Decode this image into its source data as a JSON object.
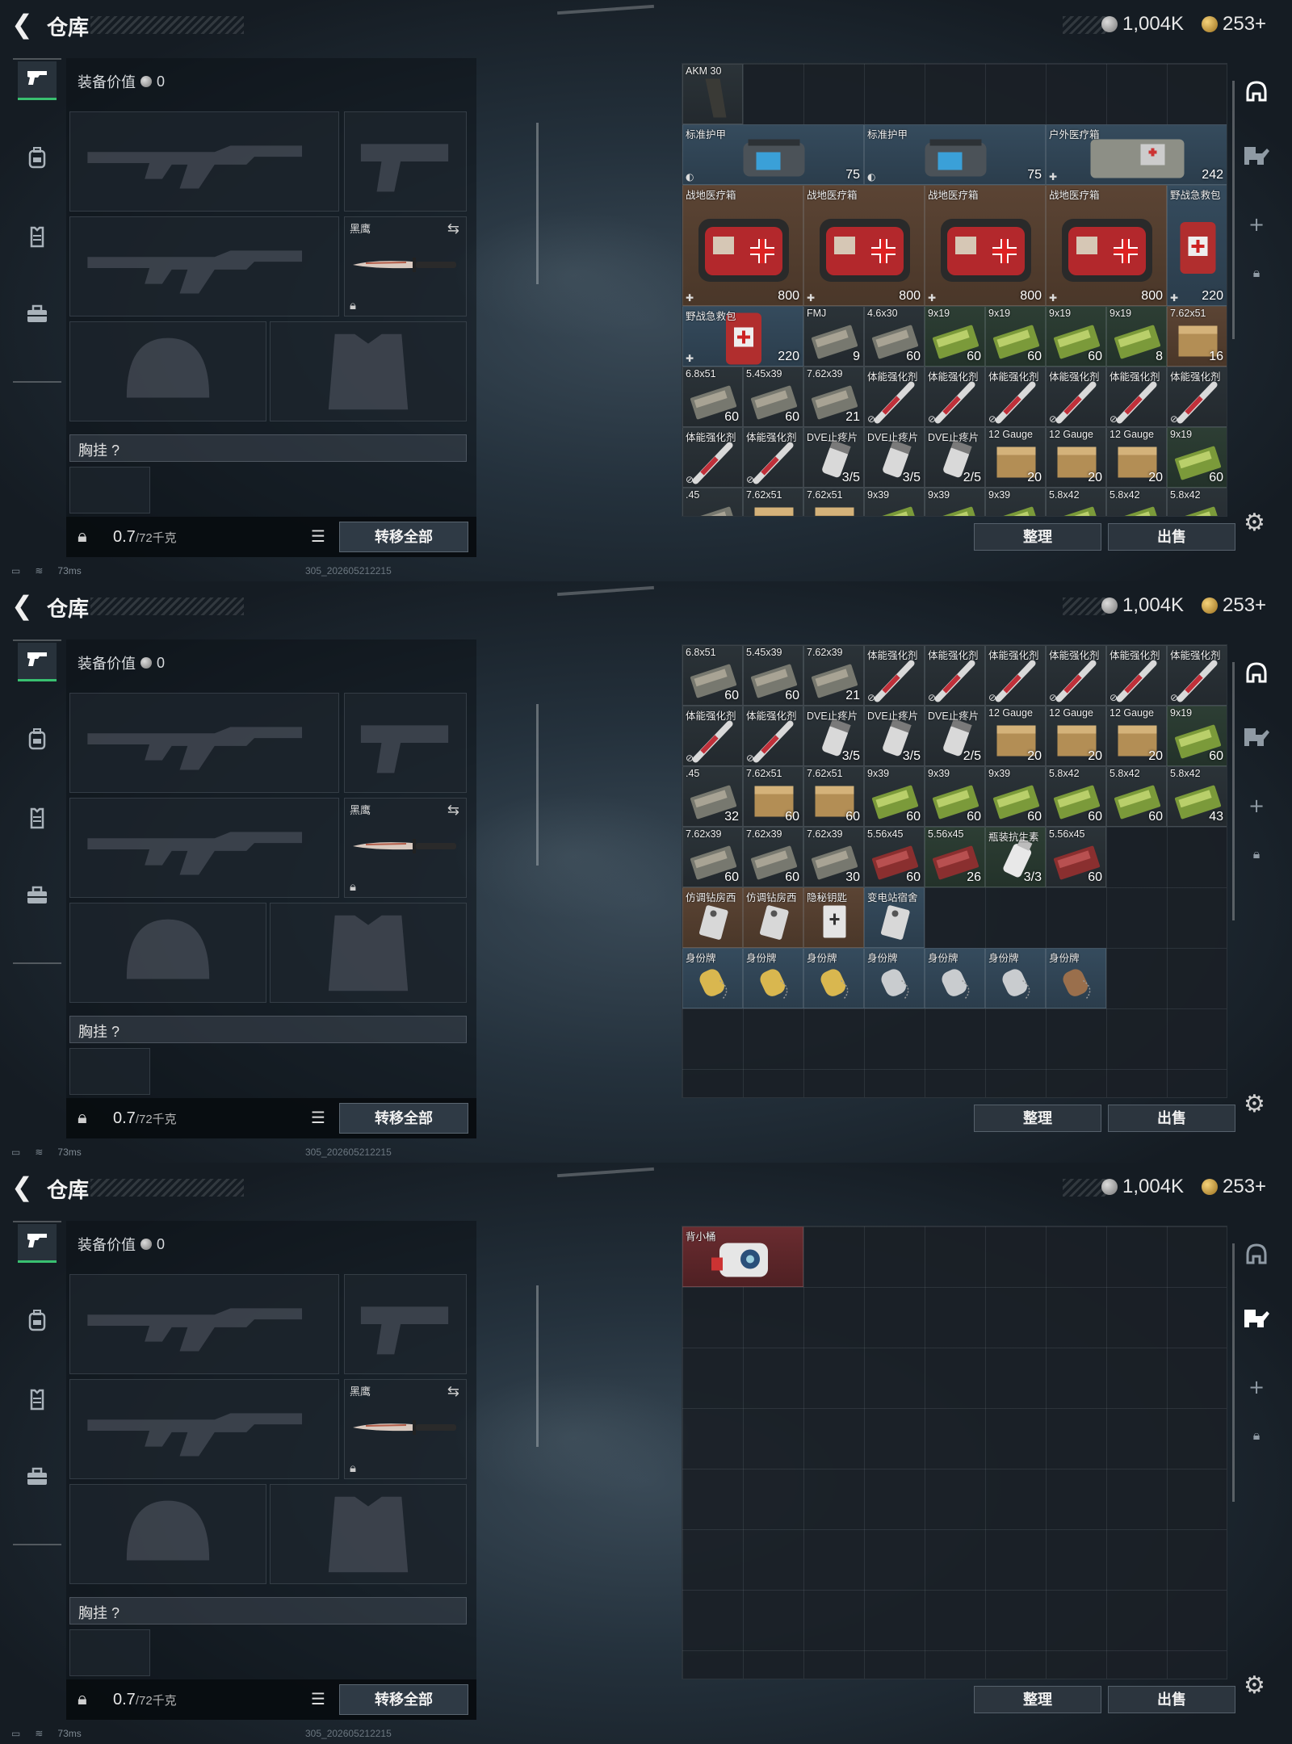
{
  "header": {
    "back_icon": "back-arrow-icon",
    "title": "仓库",
    "silver": "1,004K",
    "gold": "253+"
  },
  "left_tabs": [
    "pistol-icon",
    "backpack-icon",
    "vest-icon",
    "toolbox-icon"
  ],
  "equipment": {
    "value_label": "装备价值",
    "value": "0",
    "knife_name": "黑鹰",
    "chest_label": "胸挂",
    "chest_help": "?",
    "weight_current": "0.7",
    "weight_max": "/72千克",
    "transfer_all": "转移全部"
  },
  "status": {
    "ping": "73ms",
    "build": "305_202605212215"
  },
  "actions": {
    "sort": "整理",
    "sell": "出售"
  },
  "right_tools": [
    "helmet-icon",
    "armor-icon",
    "plus-icon",
    "lock-icon"
  ],
  "panels": [
    {
      "cells": [
        {
          "r": 0,
          "c": 0,
          "w": 1,
          "h": 1,
          "name": "AKM 30",
          "val": "",
          "bg": "dark",
          "art": "mag"
        },
        {
          "r": 1,
          "c": 0,
          "w": 3,
          "h": 1,
          "name": "标准护甲",
          "val": "75",
          "bg": "blue",
          "art": "armor",
          "corner": "◐"
        },
        {
          "r": 1,
          "c": 3,
          "w": 3,
          "h": 1,
          "name": "标准护甲",
          "val": "75",
          "bg": "blue",
          "art": "armor",
          "corner": "◐"
        },
        {
          "r": 1,
          "c": 6,
          "w": 3,
          "h": 1,
          "name": "户外医疗箱",
          "val": "242",
          "bg": "blue",
          "art": "medbag",
          "corner": "✚"
        },
        {
          "r": 2,
          "c": 0,
          "w": 2,
          "h": 2,
          "name": "战地医疗箱",
          "val": "800",
          "bg": "brown",
          "art": "firstaid",
          "corner": "✚"
        },
        {
          "r": 2,
          "c": 2,
          "w": 2,
          "h": 2,
          "name": "战地医疗箱",
          "val": "800",
          "bg": "brown",
          "art": "firstaid",
          "corner": "✚"
        },
        {
          "r": 2,
          "c": 4,
          "w": 2,
          "h": 2,
          "name": "战地医疗箱",
          "val": "800",
          "bg": "brown",
          "art": "firstaid",
          "corner": "✚"
        },
        {
          "r": 2,
          "c": 6,
          "w": 2,
          "h": 2,
          "name": "战地医疗箱",
          "val": "800",
          "bg": "brown",
          "art": "firstaid",
          "corner": "✚"
        },
        {
          "r": 2,
          "c": 8,
          "w": 1,
          "h": 2,
          "name": "野战急救包",
          "val": "220",
          "bg": "blue",
          "art": "redkit",
          "corner": "✚"
        },
        {
          "r": 4,
          "c": 0,
          "w": 2,
          "h": 1,
          "name": "野战急救包",
          "val": "220",
          "bg": "blue",
          "art": "redkit",
          "corner": "✚"
        },
        {
          "r": 4,
          "c": 2,
          "w": 1,
          "h": 1,
          "name": "FMJ",
          "val": "9",
          "bg": "dark",
          "art": "ammo-grey"
        },
        {
          "r": 4,
          "c": 3,
          "w": 1,
          "h": 1,
          "name": "4.6x30",
          "val": "60",
          "bg": "dark",
          "art": "ammo-grey"
        },
        {
          "r": 4,
          "c": 4,
          "w": 1,
          "h": 1,
          "name": "9x19",
          "val": "60",
          "bg": "green",
          "art": "ammo-green"
        },
        {
          "r": 4,
          "c": 5,
          "w": 1,
          "h": 1,
          "name": "9x19",
          "val": "60",
          "bg": "green",
          "art": "ammo-green"
        },
        {
          "r": 4,
          "c": 6,
          "w": 1,
          "h": 1,
          "name": "9x19",
          "val": "60",
          "bg": "green",
          "art": "ammo-green"
        },
        {
          "r": 4,
          "c": 7,
          "w": 1,
          "h": 1,
          "name": "9x19",
          "val": "8",
          "bg": "green",
          "art": "ammo-green"
        },
        {
          "r": 4,
          "c": 8,
          "w": 1,
          "h": 1,
          "name": "7.62x51",
          "val": "16",
          "bg": "brown",
          "art": "ammo-box"
        },
        {
          "r": 5,
          "c": 0,
          "w": 1,
          "h": 1,
          "name": "6.8x51",
          "val": "60",
          "bg": "dark",
          "art": "ammo-grey"
        },
        {
          "r": 5,
          "c": 1,
          "w": 1,
          "h": 1,
          "name": "5.45x39",
          "val": "60",
          "bg": "dark",
          "art": "ammo-grey"
        },
        {
          "r": 5,
          "c": 2,
          "w": 1,
          "h": 1,
          "name": "7.62x39",
          "val": "21",
          "bg": "dark",
          "art": "ammo-grey"
        },
        {
          "r": 5,
          "c": 3,
          "w": 1,
          "h": 1,
          "name": "体能强化剂",
          "val": "",
          "bg": "dark",
          "art": "syringe",
          "corner": "⊘"
        },
        {
          "r": 5,
          "c": 4,
          "w": 1,
          "h": 1,
          "name": "体能强化剂",
          "val": "",
          "bg": "dark",
          "art": "syringe",
          "corner": "⊘"
        },
        {
          "r": 5,
          "c": 5,
          "w": 1,
          "h": 1,
          "name": "体能强化剂",
          "val": "",
          "bg": "dark",
          "art": "syringe",
          "corner": "⊘"
        },
        {
          "r": 5,
          "c": 6,
          "w": 1,
          "h": 1,
          "name": "体能强化剂",
          "val": "",
          "bg": "dark",
          "art": "syringe",
          "corner": "⊘"
        },
        {
          "r": 5,
          "c": 7,
          "w": 1,
          "h": 1,
          "name": "体能强化剂",
          "val": "",
          "bg": "dark",
          "art": "syringe",
          "corner": "⊘"
        },
        {
          "r": 5,
          "c": 8,
          "w": 1,
          "h": 1,
          "name": "体能强化剂",
          "val": "",
          "bg": "dark",
          "art": "syringe",
          "corner": "⊘"
        },
        {
          "r": 6,
          "c": 0,
          "w": 1,
          "h": 1,
          "name": "体能强化剂",
          "val": "",
          "bg": "dark",
          "art": "syringe",
          "corner": "⊘"
        },
        {
          "r": 6,
          "c": 1,
          "w": 1,
          "h": 1,
          "name": "体能强化剂",
          "val": "",
          "bg": "dark",
          "art": "syringe",
          "corner": "⊘"
        },
        {
          "r": 6,
          "c": 2,
          "w": 1,
          "h": 1,
          "name": "DVE止疼片",
          "val": "3/5",
          "bg": "dark",
          "art": "pills"
        },
        {
          "r": 6,
          "c": 3,
          "w": 1,
          "h": 1,
          "name": "DVE止疼片",
          "val": "3/5",
          "bg": "dark",
          "art": "pills"
        },
        {
          "r": 6,
          "c": 4,
          "w": 1,
          "h": 1,
          "name": "DVE止疼片",
          "val": "2/5",
          "bg": "dark",
          "art": "pills"
        },
        {
          "r": 6,
          "c": 5,
          "w": 1,
          "h": 1,
          "name": "12 Gauge",
          "val": "20",
          "bg": "dark",
          "art": "ammo-box"
        },
        {
          "r": 6,
          "c": 6,
          "w": 1,
          "h": 1,
          "name": "12 Gauge",
          "val": "20",
          "bg": "dark",
          "art": "ammo-box"
        },
        {
          "r": 6,
          "c": 7,
          "w": 1,
          "h": 1,
          "name": "12 Gauge",
          "val": "20",
          "bg": "dark",
          "art": "ammo-box"
        },
        {
          "r": 6,
          "c": 8,
          "w": 1,
          "h": 1,
          "name": "9x19",
          "val": "60",
          "bg": "green",
          "art": "ammo-green"
        },
        {
          "r": 7,
          "c": 0,
          "w": 1,
          "h": 1,
          "name": ".45",
          "val": "",
          "bg": "dark",
          "art": "ammo-grey"
        },
        {
          "r": 7,
          "c": 1,
          "w": 1,
          "h": 1,
          "name": "7.62x51",
          "val": "",
          "bg": "dark",
          "art": "ammo-box"
        },
        {
          "r": 7,
          "c": 2,
          "w": 1,
          "h": 1,
          "name": "7.62x51",
          "val": "",
          "bg": "dark",
          "art": "ammo-box"
        },
        {
          "r": 7,
          "c": 3,
          "w": 1,
          "h": 1,
          "name": "9x39",
          "val": "",
          "bg": "dark",
          "art": "ammo-green"
        },
        {
          "r": 7,
          "c": 4,
          "w": 1,
          "h": 1,
          "name": "9x39",
          "val": "",
          "bg": "dark",
          "art": "ammo-green"
        },
        {
          "r": 7,
          "c": 5,
          "w": 1,
          "h": 1,
          "name": "9x39",
          "val": "",
          "bg": "dark",
          "art": "ammo-green"
        },
        {
          "r": 7,
          "c": 6,
          "w": 1,
          "h": 1,
          "name": "5.8x42",
          "val": "",
          "bg": "dark",
          "art": "ammo-green"
        },
        {
          "r": 7,
          "c": 7,
          "w": 1,
          "h": 1,
          "name": "5.8x42",
          "val": "",
          "bg": "dark",
          "art": "ammo-green"
        },
        {
          "r": 7,
          "c": 8,
          "w": 1,
          "h": 1,
          "name": "5.8x42",
          "val": "",
          "bg": "dark",
          "art": "ammo-green"
        }
      ]
    },
    {
      "cells": [
        {
          "r": 0,
          "c": 0,
          "w": 1,
          "h": 1,
          "name": "6.8x51",
          "val": "60",
          "bg": "dark",
          "art": "ammo-grey"
        },
        {
          "r": 0,
          "c": 1,
          "w": 1,
          "h": 1,
          "name": "5.45x39",
          "val": "60",
          "bg": "dark",
          "art": "ammo-grey"
        },
        {
          "r": 0,
          "c": 2,
          "w": 1,
          "h": 1,
          "name": "7.62x39",
          "val": "21",
          "bg": "dark",
          "art": "ammo-grey"
        },
        {
          "r": 0,
          "c": 3,
          "w": 1,
          "h": 1,
          "name": "体能强化剂",
          "val": "",
          "bg": "dark",
          "art": "syringe",
          "corner": "⊘"
        },
        {
          "r": 0,
          "c": 4,
          "w": 1,
          "h": 1,
          "name": "体能强化剂",
          "val": "",
          "bg": "dark",
          "art": "syringe",
          "corner": "⊘"
        },
        {
          "r": 0,
          "c": 5,
          "w": 1,
          "h": 1,
          "name": "体能强化剂",
          "val": "",
          "bg": "dark",
          "art": "syringe",
          "corner": "⊘"
        },
        {
          "r": 0,
          "c": 6,
          "w": 1,
          "h": 1,
          "name": "体能强化剂",
          "val": "",
          "bg": "dark",
          "art": "syringe",
          "corner": "⊘"
        },
        {
          "r": 0,
          "c": 7,
          "w": 1,
          "h": 1,
          "name": "体能强化剂",
          "val": "",
          "bg": "dark",
          "art": "syringe",
          "corner": "⊘"
        },
        {
          "r": 0,
          "c": 8,
          "w": 1,
          "h": 1,
          "name": "体能强化剂",
          "val": "",
          "bg": "dark",
          "art": "syringe",
          "corner": "⊘"
        },
        {
          "r": 1,
          "c": 0,
          "w": 1,
          "h": 1,
          "name": "体能强化剂",
          "val": "",
          "bg": "dark",
          "art": "syringe",
          "corner": "⊘"
        },
        {
          "r": 1,
          "c": 1,
          "w": 1,
          "h": 1,
          "name": "体能强化剂",
          "val": "",
          "bg": "dark",
          "art": "syringe",
          "corner": "⊘"
        },
        {
          "r": 1,
          "c": 2,
          "w": 1,
          "h": 1,
          "name": "DVE止疼片",
          "val": "3/5",
          "bg": "dark",
          "art": "pills"
        },
        {
          "r": 1,
          "c": 3,
          "w": 1,
          "h": 1,
          "name": "DVE止疼片",
          "val": "3/5",
          "bg": "dark",
          "art": "pills"
        },
        {
          "r": 1,
          "c": 4,
          "w": 1,
          "h": 1,
          "name": "DVE止疼片",
          "val": "2/5",
          "bg": "dark",
          "art": "pills"
        },
        {
          "r": 1,
          "c": 5,
          "w": 1,
          "h": 1,
          "name": "12 Gauge",
          "val": "20",
          "bg": "dark",
          "art": "ammo-box"
        },
        {
          "r": 1,
          "c": 6,
          "w": 1,
          "h": 1,
          "name": "12 Gauge",
          "val": "20",
          "bg": "dark",
          "art": "ammo-box"
        },
        {
          "r": 1,
          "c": 7,
          "w": 1,
          "h": 1,
          "name": "12 Gauge",
          "val": "20",
          "bg": "dark",
          "art": "ammo-box"
        },
        {
          "r": 1,
          "c": 8,
          "w": 1,
          "h": 1,
          "name": "9x19",
          "val": "60",
          "bg": "green",
          "art": "ammo-green"
        },
        {
          "r": 2,
          "c": 0,
          "w": 1,
          "h": 1,
          "name": ".45",
          "val": "32",
          "bg": "dark",
          "art": "ammo-grey"
        },
        {
          "r": 2,
          "c": 1,
          "w": 1,
          "h": 1,
          "name": "7.62x51",
          "val": "60",
          "bg": "dark",
          "art": "ammo-box"
        },
        {
          "r": 2,
          "c": 2,
          "w": 1,
          "h": 1,
          "name": "7.62x51",
          "val": "60",
          "bg": "dark",
          "art": "ammo-box"
        },
        {
          "r": 2,
          "c": 3,
          "w": 1,
          "h": 1,
          "name": "9x39",
          "val": "60",
          "bg": "dark",
          "art": "ammo-green"
        },
        {
          "r": 2,
          "c": 4,
          "w": 1,
          "h": 1,
          "name": "9x39",
          "val": "60",
          "bg": "dark",
          "art": "ammo-green"
        },
        {
          "r": 2,
          "c": 5,
          "w": 1,
          "h": 1,
          "name": "9x39",
          "val": "60",
          "bg": "dark",
          "art": "ammo-green"
        },
        {
          "r": 2,
          "c": 6,
          "w": 1,
          "h": 1,
          "name": "5.8x42",
          "val": "60",
          "bg": "dark",
          "art": "ammo-green"
        },
        {
          "r": 2,
          "c": 7,
          "w": 1,
          "h": 1,
          "name": "5.8x42",
          "val": "60",
          "bg": "dark",
          "art": "ammo-green"
        },
        {
          "r": 2,
          "c": 8,
          "w": 1,
          "h": 1,
          "name": "5.8x42",
          "val": "43",
          "bg": "dark",
          "art": "ammo-green"
        },
        {
          "r": 3,
          "c": 0,
          "w": 1,
          "h": 1,
          "name": "7.62x39",
          "val": "60",
          "bg": "dark",
          "art": "ammo-grey"
        },
        {
          "r": 3,
          "c": 1,
          "w": 1,
          "h": 1,
          "name": "7.62x39",
          "val": "60",
          "bg": "dark",
          "art": "ammo-grey"
        },
        {
          "r": 3,
          "c": 2,
          "w": 1,
          "h": 1,
          "name": "7.62x39",
          "val": "30",
          "bg": "dark",
          "art": "ammo-grey"
        },
        {
          "r": 3,
          "c": 3,
          "w": 1,
          "h": 1,
          "name": "5.56x45",
          "val": "60",
          "bg": "dark",
          "art": "ammo-red"
        },
        {
          "r": 3,
          "c": 4,
          "w": 1,
          "h": 1,
          "name": "5.56x45",
          "val": "26",
          "bg": "green",
          "art": "ammo-red"
        },
        {
          "r": 3,
          "c": 5,
          "w": 1,
          "h": 1,
          "name": "瓶装抗生素",
          "val": "3/3",
          "bg": "green",
          "art": "bottle"
        },
        {
          "r": 3,
          "c": 6,
          "w": 1,
          "h": 1,
          "name": "5.56x45",
          "val": "60",
          "bg": "dark",
          "art": "ammo-red"
        },
        {
          "r": 4,
          "c": 0,
          "w": 1,
          "h": 1,
          "name": "仿调钻房西",
          "val": "",
          "bg": "brown",
          "art": "tag"
        },
        {
          "r": 4,
          "c": 1,
          "w": 1,
          "h": 1,
          "name": "仿调钻房西",
          "val": "",
          "bg": "brown",
          "art": "tag"
        },
        {
          "r": 4,
          "c": 2,
          "w": 1,
          "h": 1,
          "name": "隐秘钥匙",
          "val": "",
          "bg": "brown",
          "art": "card"
        },
        {
          "r": 4,
          "c": 3,
          "w": 1,
          "h": 1,
          "name": "变电站宿舍",
          "val": "",
          "bg": "blue",
          "art": "tag"
        },
        {
          "r": 5,
          "c": 0,
          "w": 1,
          "h": 1,
          "name": "身份牌",
          "val": "",
          "bg": "blue",
          "art": "dogtag-gold"
        },
        {
          "r": 5,
          "c": 1,
          "w": 1,
          "h": 1,
          "name": "身份牌",
          "val": "",
          "bg": "blue",
          "art": "dogtag-gold"
        },
        {
          "r": 5,
          "c": 2,
          "w": 1,
          "h": 1,
          "name": "身份牌",
          "val": "",
          "bg": "blue",
          "art": "dogtag-gold"
        },
        {
          "r": 5,
          "c": 3,
          "w": 1,
          "h": 1,
          "name": "身份牌",
          "val": "",
          "bg": "blue",
          "art": "dogtag-silver"
        },
        {
          "r": 5,
          "c": 4,
          "w": 1,
          "h": 1,
          "name": "身份牌",
          "val": "",
          "bg": "blue",
          "art": "dogtag-silver"
        },
        {
          "r": 5,
          "c": 5,
          "w": 1,
          "h": 1,
          "name": "身份牌",
          "val": "",
          "bg": "blue",
          "art": "dogtag-silver"
        },
        {
          "r": 5,
          "c": 6,
          "w": 1,
          "h": 1,
          "name": "身份牌",
          "val": "",
          "bg": "blue",
          "art": "dogtag-bronze"
        }
      ]
    },
    {
      "cells": [
        {
          "r": 0,
          "c": 0,
          "w": 2,
          "h": 1,
          "name": "背小桶",
          "val": "",
          "bg": "red",
          "art": "robot"
        }
      ]
    }
  ]
}
